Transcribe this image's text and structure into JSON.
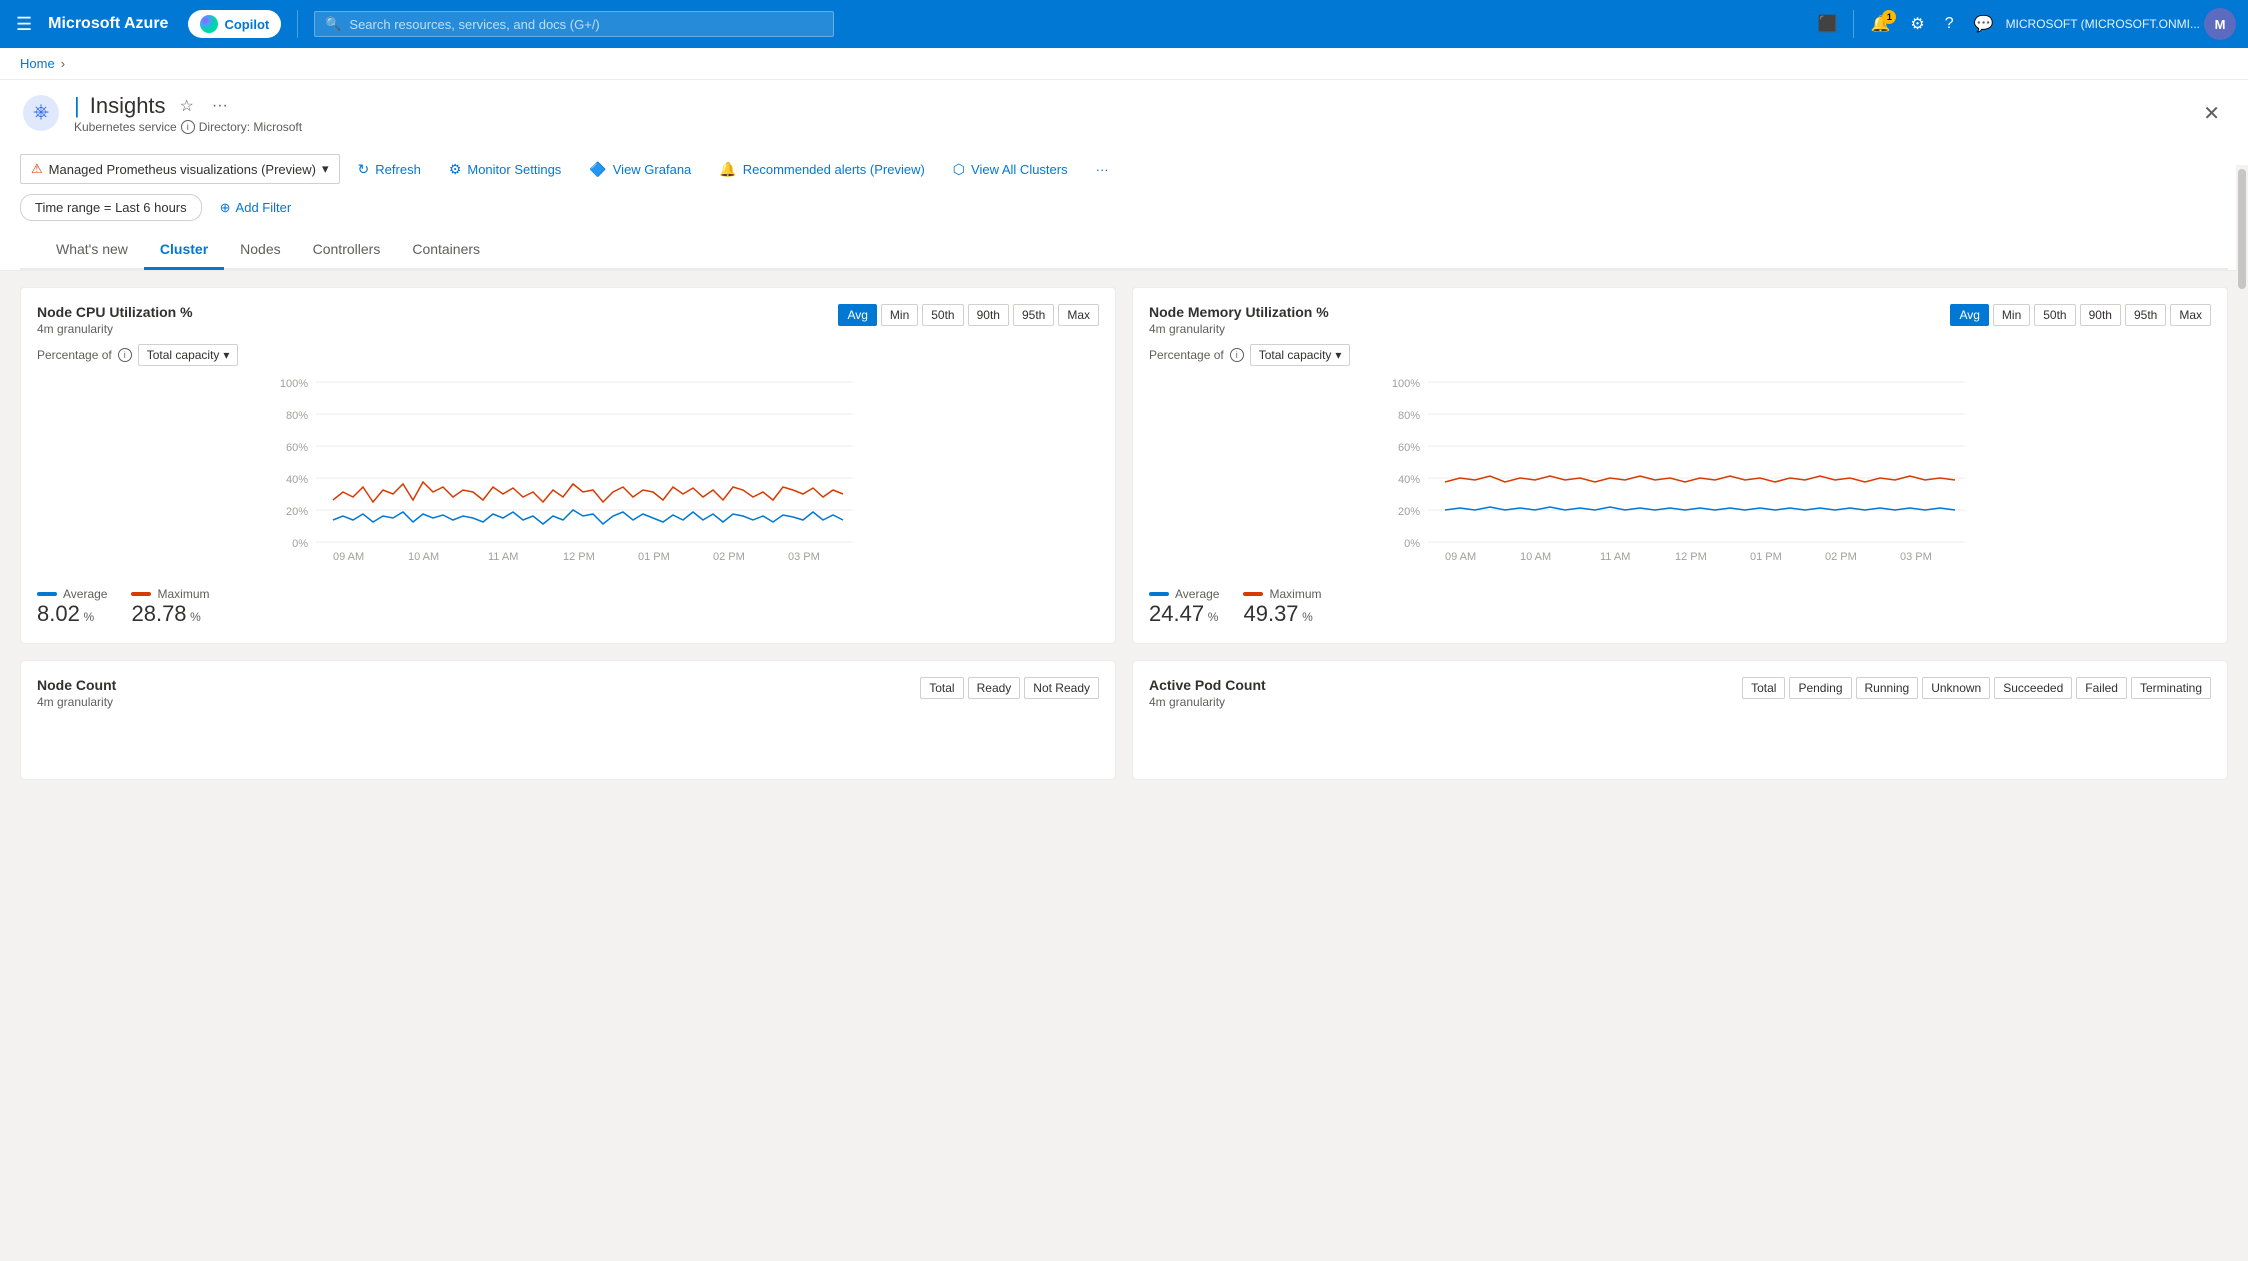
{
  "topnav": {
    "hamburger": "☰",
    "brand": "Microsoft Azure",
    "search_placeholder": "Search resources, services, and docs (G+/)",
    "copilot_label": "Copilot",
    "notification_count": "1",
    "org_text": "MICROSOFT (MICROSOFT.ONMI...",
    "icons": {
      "shell": "⬛",
      "bell": "🔔",
      "settings": "⚙",
      "help": "?",
      "feedback": "💬"
    }
  },
  "breadcrumb": {
    "home": "Home",
    "chevron": "›"
  },
  "page": {
    "icon_label": "K8s",
    "subtitle_service": "Kubernetes service",
    "subtitle_directory": "Directory: Microsoft",
    "title_pipe": "|",
    "title": "Insights",
    "star": "☆",
    "more": "···",
    "close": "✕"
  },
  "toolbar": {
    "managed_btn": "Managed Prometheus visualizations (Preview)",
    "refresh": "Refresh",
    "monitor_settings": "Monitor Settings",
    "view_grafana": "View Grafana",
    "recommended_alerts": "Recommended alerts (Preview)",
    "view_all_clusters": "View All Clusters",
    "overflow": "···"
  },
  "filters": {
    "time_range_label": "Time range = Last 6 hours",
    "add_filter": "Add Filter"
  },
  "tabs": [
    {
      "id": "whats-new",
      "label": "What's new",
      "active": false
    },
    {
      "id": "cluster",
      "label": "Cluster",
      "active": true
    },
    {
      "id": "nodes",
      "label": "Nodes",
      "active": false
    },
    {
      "id": "controllers",
      "label": "Controllers",
      "active": false
    },
    {
      "id": "containers",
      "label": "Containers",
      "active": false
    }
  ],
  "cpu_chart": {
    "title": "Node CPU Utilization %",
    "granularity": "4m granularity",
    "stat_buttons": [
      "Avg",
      "Min",
      "50th",
      "90th",
      "95th",
      "Max"
    ],
    "active_stat": "Avg",
    "percentage_of": "Percentage of",
    "dropdown": "Total capacity",
    "y_labels": [
      "100%",
      "80%",
      "60%",
      "40%",
      "20%",
      "0%"
    ],
    "x_labels": [
      "09 AM",
      "10 AM",
      "11 AM",
      "12 PM",
      "01 PM",
      "02 PM",
      "03 PM"
    ],
    "legend_average_label": "Average",
    "legend_average_value": "8.02",
    "legend_average_unit": "%",
    "legend_average_color": "#0078d4",
    "legend_max_label": "Maximum",
    "legend_max_value": "28.78",
    "legend_max_unit": "%",
    "legend_max_color": "#d83b01"
  },
  "memory_chart": {
    "title": "Node Memory Utilization %",
    "granularity": "4m granularity",
    "stat_buttons": [
      "Avg",
      "Min",
      "50th",
      "90th",
      "95th",
      "Max"
    ],
    "active_stat": "Avg",
    "percentage_of": "Percentage of",
    "dropdown": "Total capacity",
    "y_labels": [
      "100%",
      "80%",
      "60%",
      "40%",
      "20%",
      "0%"
    ],
    "x_labels": [
      "09 AM",
      "10 AM",
      "11 AM",
      "12 PM",
      "01 PM",
      "02 PM",
      "03 PM"
    ],
    "legend_average_label": "Average",
    "legend_average_value": "24.47",
    "legend_average_unit": "%",
    "legend_average_color": "#0078d4",
    "legend_max_label": "Maximum",
    "legend_max_value": "49.37",
    "legend_max_unit": "%",
    "legend_max_color": "#d83b01"
  },
  "node_count": {
    "title": "Node Count",
    "granularity": "4m granularity",
    "buttons": [
      "Total",
      "Ready",
      "Not Ready"
    ]
  },
  "active_pod_count": {
    "title": "Active Pod Count",
    "granularity": "4m granularity",
    "buttons": [
      "Total",
      "Pending",
      "Running",
      "Unknown",
      "Succeeded",
      "Failed",
      "Terminating"
    ]
  }
}
